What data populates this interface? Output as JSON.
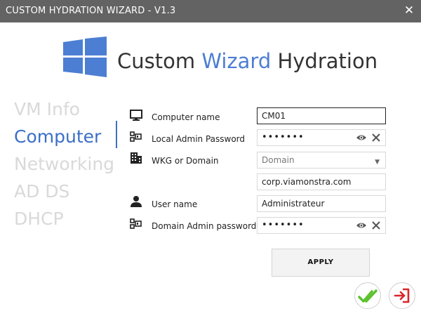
{
  "window": {
    "title": "CUSTOM HYDRATION WIZARD - V1.3",
    "close_icon": "close-icon"
  },
  "header": {
    "title_part1": "Custom ",
    "title_accent": "Wizard",
    "title_part2": " Hydration",
    "logo_icon": "windows-logo-icon",
    "accent_color": "#4c7ed3"
  },
  "nav": {
    "items": [
      {
        "label": "VM Info",
        "active": false
      },
      {
        "label": "Computer",
        "active": true
      },
      {
        "label": "Networking",
        "active": false
      },
      {
        "label": "AD DS",
        "active": false
      },
      {
        "label": "DHCP",
        "active": false
      }
    ],
    "active_color": "#3b6fc7",
    "inactive_color": "#d9d9d9"
  },
  "form": {
    "computer_name": {
      "label": "Computer name",
      "value": "CM01",
      "icon": "monitor-icon"
    },
    "local_admin_password": {
      "label": "Local Admin Password",
      "value": "•••••••",
      "icon": "password-key-icon"
    },
    "wkg_or_domain": {
      "label": "WKG or Domain",
      "value": "Domain",
      "icon": "building-icon"
    },
    "domain_name": {
      "value": "corp.viamonstra.com"
    },
    "user_name": {
      "label": "User name",
      "value": "Administrateur",
      "icon": "user-icon"
    },
    "domain_admin_password": {
      "label": "Domain Admin password",
      "value": "•••••••",
      "icon": "password-key-icon"
    }
  },
  "buttons": {
    "apply_label": "APPLY",
    "confirm_icon": "double-check-icon",
    "exit_icon": "exit-icon"
  }
}
